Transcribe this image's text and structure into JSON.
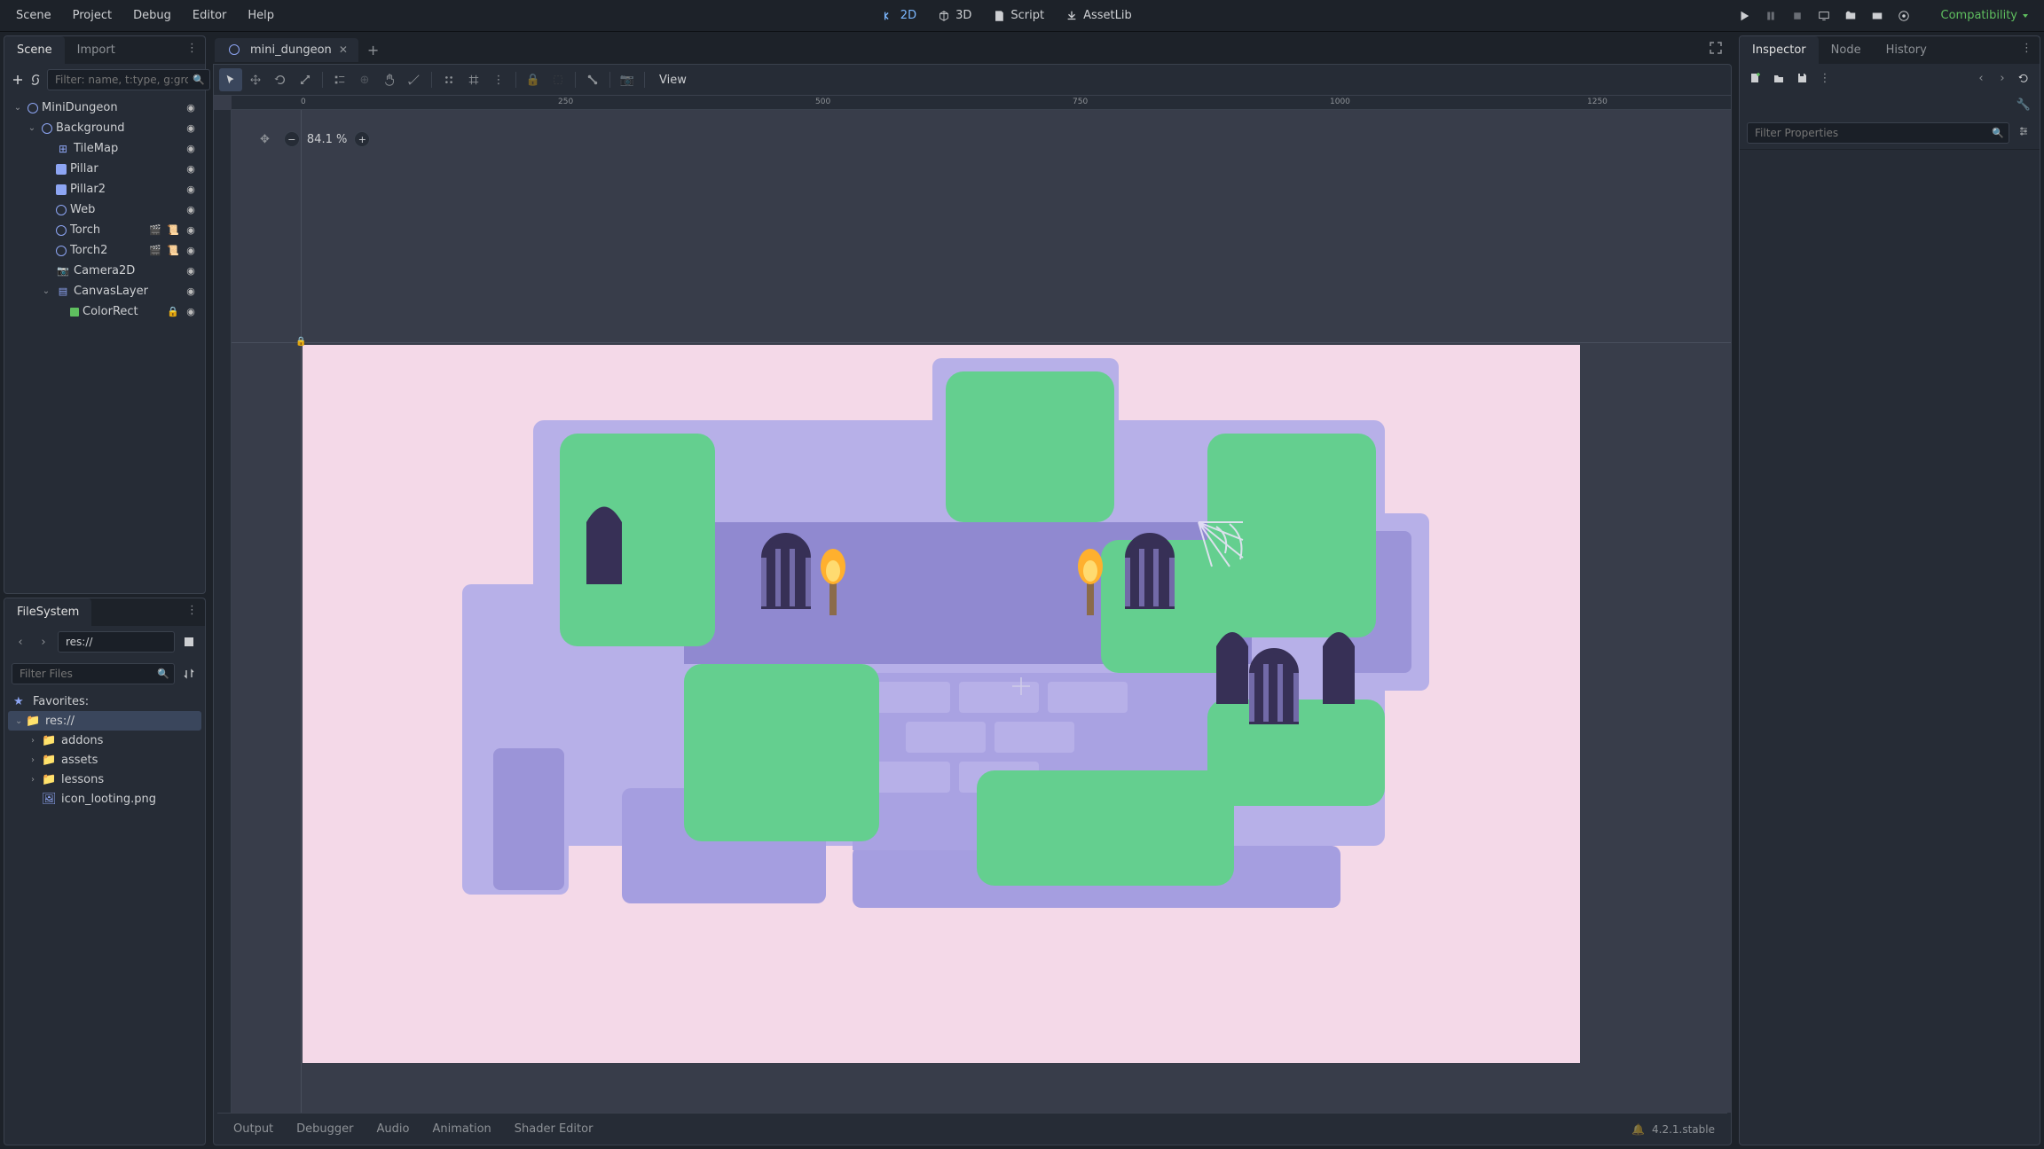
{
  "top_menu": {
    "scene": "Scene",
    "project": "Project",
    "debug": "Debug",
    "editor": "Editor",
    "help": "Help"
  },
  "center_modes": {
    "2d": "2D",
    "3d": "3D",
    "script": "Script",
    "assetlib": "AssetLib"
  },
  "renderer": {
    "label": "Compatibility"
  },
  "scene_dock": {
    "tab_scene": "Scene",
    "tab_import": "Import",
    "filter_placeholder": "Filter: name, t:type, g:group",
    "nodes": [
      {
        "name": "MiniDungeon",
        "depth": 0,
        "icon": "circle",
        "toggle": true,
        "open": true,
        "vis": true
      },
      {
        "name": "Background",
        "depth": 1,
        "icon": "circle",
        "toggle": true,
        "open": true,
        "vis": true
      },
      {
        "name": "TileMap",
        "depth": 2,
        "icon": "grid",
        "vis": true
      },
      {
        "name": "Pillar",
        "depth": 2,
        "icon": "sprite",
        "vis": true
      },
      {
        "name": "Pillar2",
        "depth": 2,
        "icon": "sprite",
        "vis": true
      },
      {
        "name": "Web",
        "depth": 2,
        "icon": "circle",
        "vis": true
      },
      {
        "name": "Torch",
        "depth": 2,
        "icon": "circle",
        "vis": true,
        "extras": [
          "clapper",
          "script"
        ]
      },
      {
        "name": "Torch2",
        "depth": 2,
        "icon": "circle",
        "vis": true,
        "extras": [
          "clapper",
          "script"
        ]
      },
      {
        "name": "Camera2D",
        "depth": 2,
        "icon": "cam",
        "vis": true
      },
      {
        "name": "CanvasLayer",
        "depth": 2,
        "icon": "layer",
        "toggle": true,
        "open": true,
        "vis": true
      },
      {
        "name": "ColorRect",
        "depth": 3,
        "icon": "rect",
        "vis": true,
        "extras": [
          "lock"
        ]
      }
    ]
  },
  "filesystem": {
    "tab": "FileSystem",
    "path": "res://",
    "filter_placeholder": "Filter Files",
    "favorites": "Favorites:",
    "items": [
      {
        "name": "res://",
        "type": "folder",
        "depth": 0,
        "open": true,
        "selected": true
      },
      {
        "name": "addons",
        "type": "folder",
        "depth": 1,
        "closed": true
      },
      {
        "name": "assets",
        "type": "folder",
        "depth": 1,
        "closed": true
      },
      {
        "name": "lessons",
        "type": "folder",
        "depth": 1,
        "closed": true
      },
      {
        "name": "icon_looting.png",
        "type": "file",
        "depth": 1
      }
    ]
  },
  "scene_tabs": {
    "tab1": "mini_dungeon"
  },
  "viewport": {
    "zoom_text": "84.1 %",
    "ruler_marks": [
      "0",
      "250",
      "500",
      "750",
      "1000",
      "1250"
    ],
    "view_btn": "View"
  },
  "bottom": {
    "tabs": [
      "Output",
      "Debugger",
      "Audio",
      "Animation",
      "Shader Editor"
    ],
    "version": "4.2.1.stable"
  },
  "inspector": {
    "tab_inspector": "Inspector",
    "tab_node": "Node",
    "tab_history": "History",
    "filter_placeholder": "Filter Properties"
  }
}
